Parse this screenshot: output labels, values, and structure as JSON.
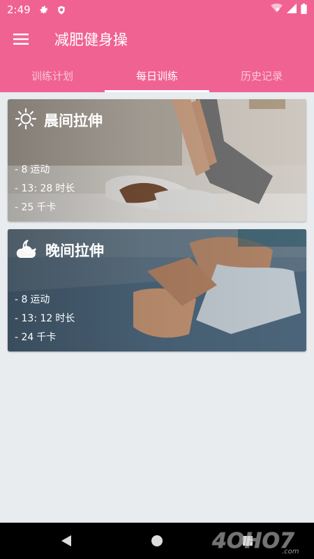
{
  "status_bar": {
    "time": "2:49",
    "icons": [
      "gear-icon",
      "shield-icon",
      "wifi-icon",
      "signal-icon",
      "battery-icon"
    ]
  },
  "app_bar": {
    "title": "减肥健身操",
    "menu_icon": "hamburger-menu-icon"
  },
  "tabs": [
    {
      "label": "训练计划",
      "active": false
    },
    {
      "label": "每日训练",
      "active": true
    },
    {
      "label": "历史记录",
      "active": false
    }
  ],
  "workouts": [
    {
      "title": "晨间拉伸",
      "icon": "sun-icon",
      "exercises": "- 8",
      "exercises_unit": "运动",
      "duration": "- 13: 28",
      "duration_unit": "时长",
      "calories": "- 25",
      "calories_unit": "千卡"
    },
    {
      "title": "晚间拉伸",
      "icon": "moon-cloud-icon",
      "exercises": "- 8",
      "exercises_unit": "运动",
      "duration": "- 13: 12",
      "duration_unit": "时长",
      "calories": "- 24",
      "calories_unit": "千卡"
    }
  ],
  "nav_bar": {
    "icons": [
      "back-icon",
      "home-icon",
      "recents-icon"
    ]
  },
  "watermark": "4OHO7.com",
  "colors": {
    "primary": "#f06292",
    "background": "#e8ecef",
    "nav_bar": "#000000"
  }
}
